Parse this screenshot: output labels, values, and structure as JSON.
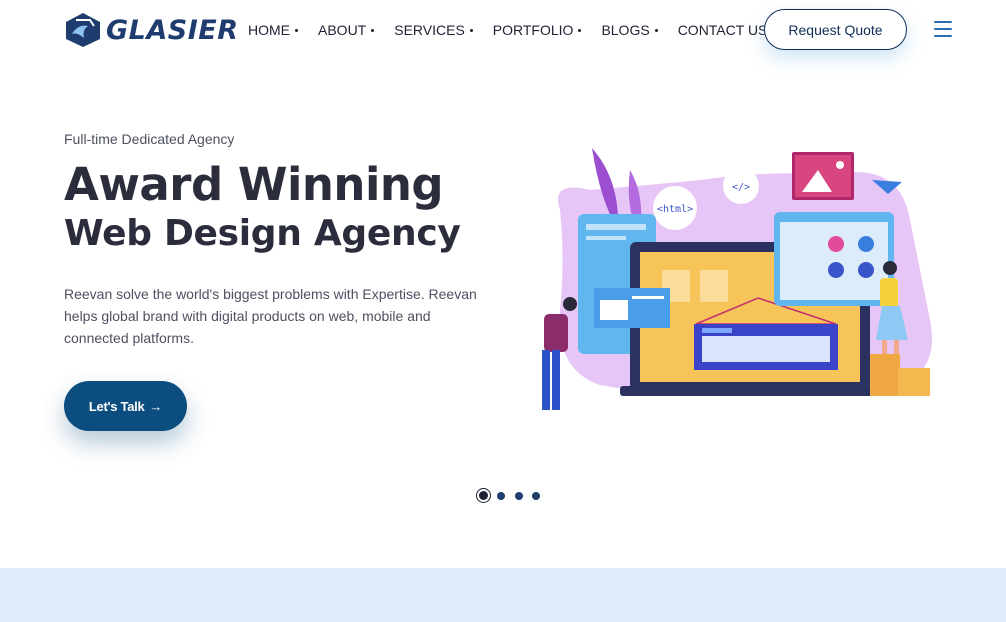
{
  "brand": {
    "name": "GLASIER"
  },
  "nav": {
    "items": [
      {
        "label": "HOME"
      },
      {
        "label": "ABOUT"
      },
      {
        "label": "SERVICES"
      },
      {
        "label": "PORTFOLIO"
      },
      {
        "label": "BLOGS"
      },
      {
        "label": "CONTACT US"
      }
    ],
    "quote_label": "Request Quote",
    "menu_icon": "hamburger-menu-icon"
  },
  "hero": {
    "eyebrow": "Full-time Dedicated Agency",
    "title_line1": "Award Winning",
    "title_line2": "Web Design Agency",
    "description": "Reevan solve the world's biggest problems with Expertise. Reevan helps global brand with digital products on web, mobile and connected platforms.",
    "cta_label": "Let's Talk",
    "cta_arrow": "→",
    "illustration_html_tag": "<html>",
    "illustration_code_tag": "</>"
  },
  "slider": {
    "count": 4,
    "active": 0
  },
  "colors": {
    "primary": "#0b4d7f",
    "navy": "#1f3c6e",
    "band": "#e0ecfc",
    "accent": "#2a6db5"
  }
}
